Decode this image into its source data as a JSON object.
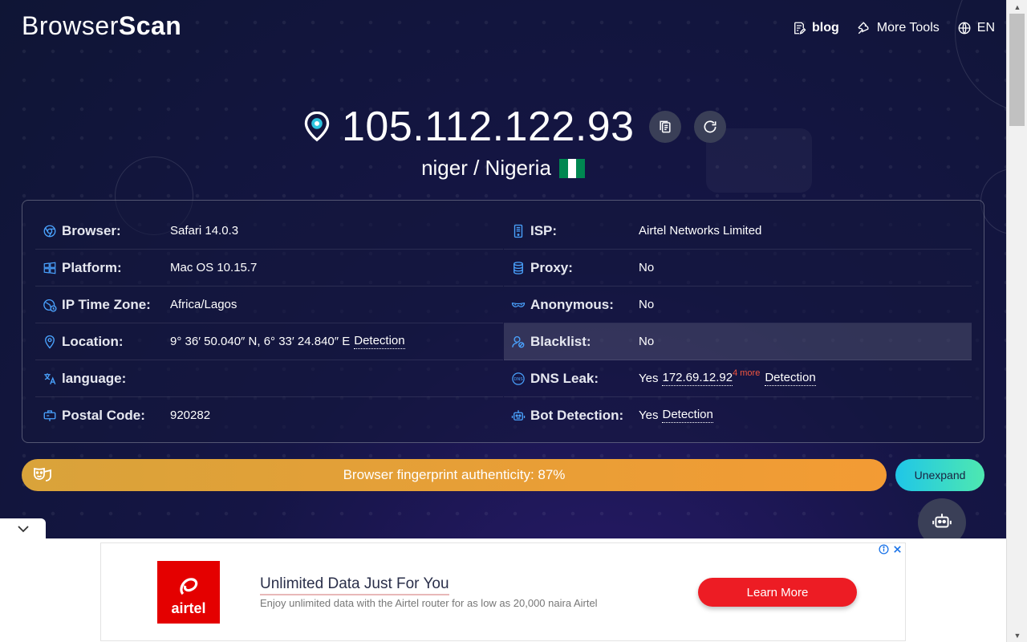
{
  "header": {
    "logo_text": "BrowserScan",
    "nav": [
      {
        "label": "blog",
        "icon": "document-edit-icon"
      },
      {
        "label": "More Tools",
        "icon": "wrench-icon"
      },
      {
        "label": "EN",
        "icon": "globe-icon"
      }
    ]
  },
  "hero": {
    "ip": "105.112.122.93",
    "location": "niger / Nigeria",
    "flag_colors": [
      "#008751",
      "#ffffff",
      "#008751"
    ]
  },
  "info": {
    "left": [
      {
        "label": "Browser:",
        "value": "Safari 14.0.3",
        "icon": "chrome-icon"
      },
      {
        "label": "Platform:",
        "value": "Mac OS 10.15.7",
        "icon": "windows-icon",
        "value_color": "red"
      },
      {
        "label": "IP Time Zone:",
        "value": "Africa/Lagos",
        "icon": "globe-clock-icon"
      },
      {
        "label": "Location:",
        "value": "9° 36′ 50.040″ N, 6° 33′ 24.840″ E",
        "link": "Detection",
        "icon": "location-pin-icon"
      },
      {
        "label": "language:",
        "value": "",
        "icon": "translate-icon"
      },
      {
        "label": "Postal Code:",
        "value": "920282",
        "icon": "postal-icon"
      }
    ],
    "right": [
      {
        "label": "ISP:",
        "value": "Airtel Networks Limited",
        "icon": "server-icon"
      },
      {
        "label": "Proxy:",
        "value": "No",
        "icon": "database-icon"
      },
      {
        "label": "Anonymous:",
        "value": "No",
        "icon": "mask-icon"
      },
      {
        "label": "Blacklist:",
        "value": "No",
        "icon": "user-block-icon"
      },
      {
        "label": "DNS Leak:",
        "status": "Yes",
        "value": "172.69.12.92",
        "more": "4 more",
        "link": "Detection",
        "icon": "dns-icon"
      },
      {
        "label": "Bot Detection:",
        "status": "Yes",
        "link": "Detection",
        "icon": "robot-icon"
      }
    ]
  },
  "authenticity": {
    "label": "Browser fingerprint authenticity: 87%",
    "percent": 87,
    "button": "Unexpand"
  },
  "ad": {
    "brand": "airtel",
    "title": "Unlimited Data Just For You",
    "subtitle": "Enjoy unlimited data with the Airtel router for as low as 20,000 naira Airtel",
    "cta": "Learn More"
  },
  "colors": {
    "accent_blue": "#4aa3ff",
    "warning_red": "#f2553f",
    "bar_gradient_start": "#d9a33a",
    "bar_gradient_end": "#f39b34"
  }
}
